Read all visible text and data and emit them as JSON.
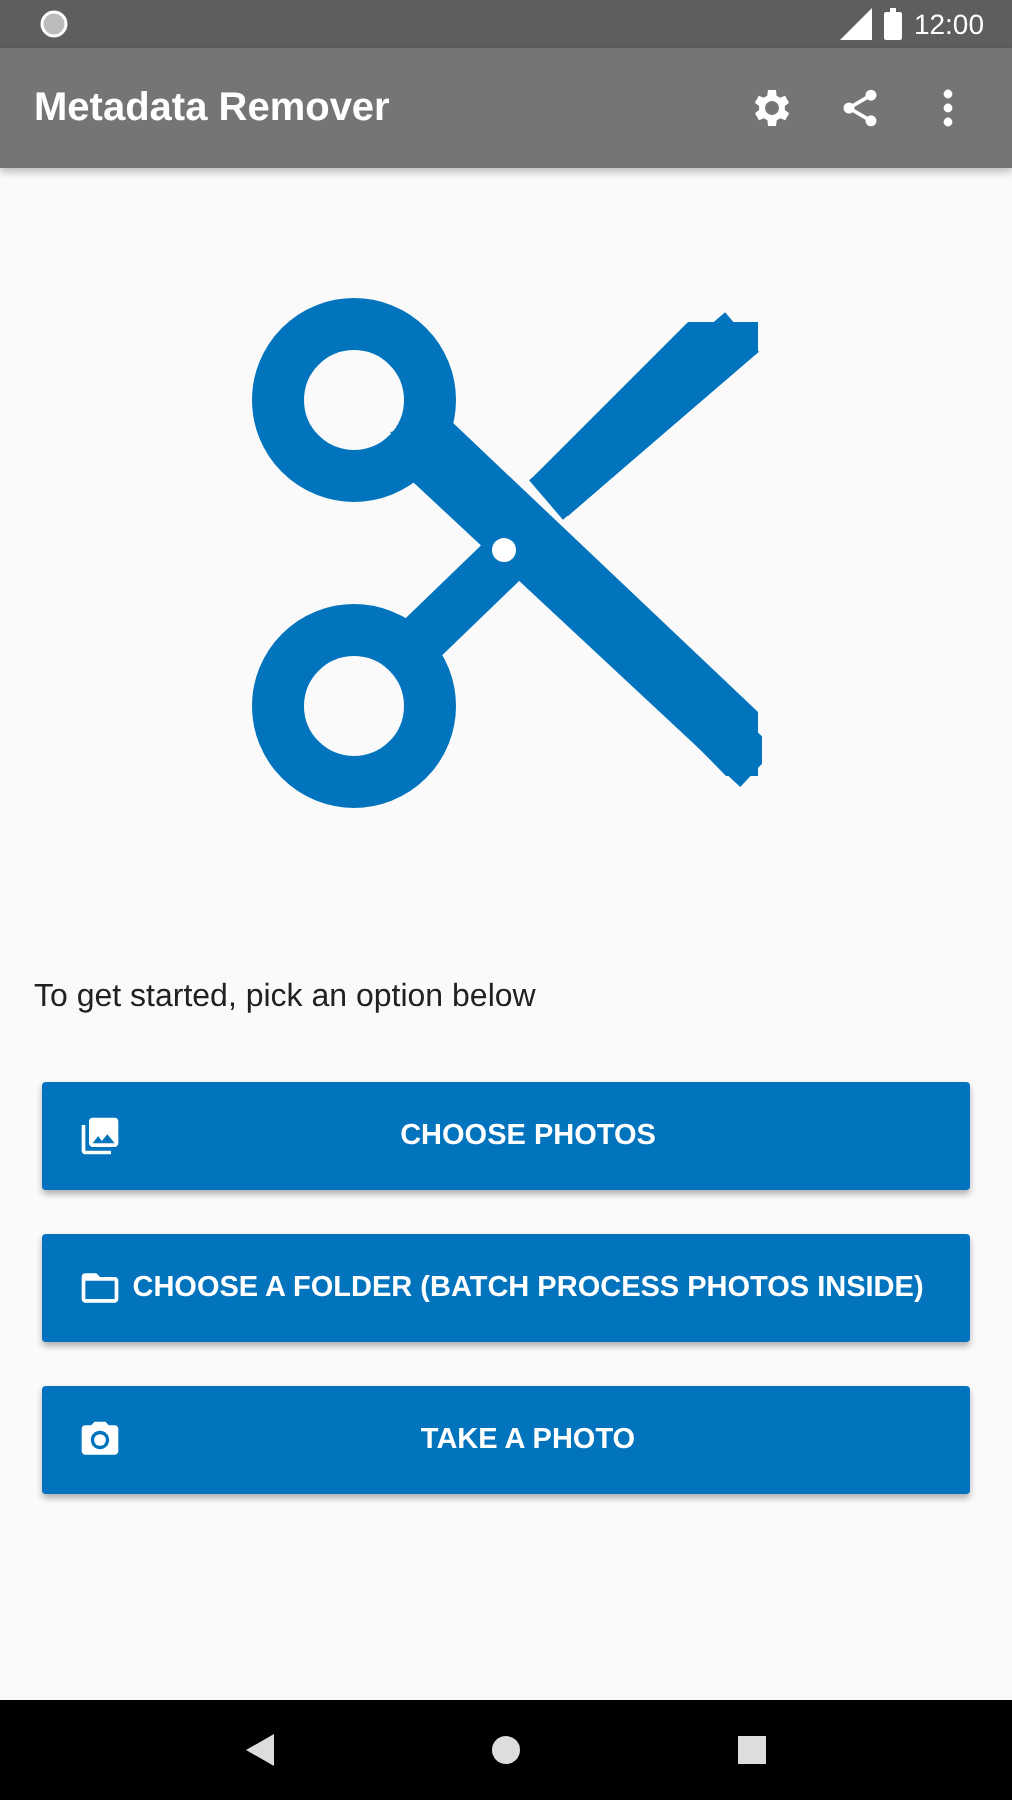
{
  "status_bar": {
    "time": "12:00"
  },
  "app_bar": {
    "title": "Metadata Remover"
  },
  "prompt": "To get started, pick an option below",
  "buttons": [
    {
      "label": "CHOOSE PHOTOS"
    },
    {
      "label": "CHOOSE A FOLDER (BATCH PROCESS PHOTOS INSIDE)"
    },
    {
      "label": "TAKE A PHOTO"
    }
  ]
}
